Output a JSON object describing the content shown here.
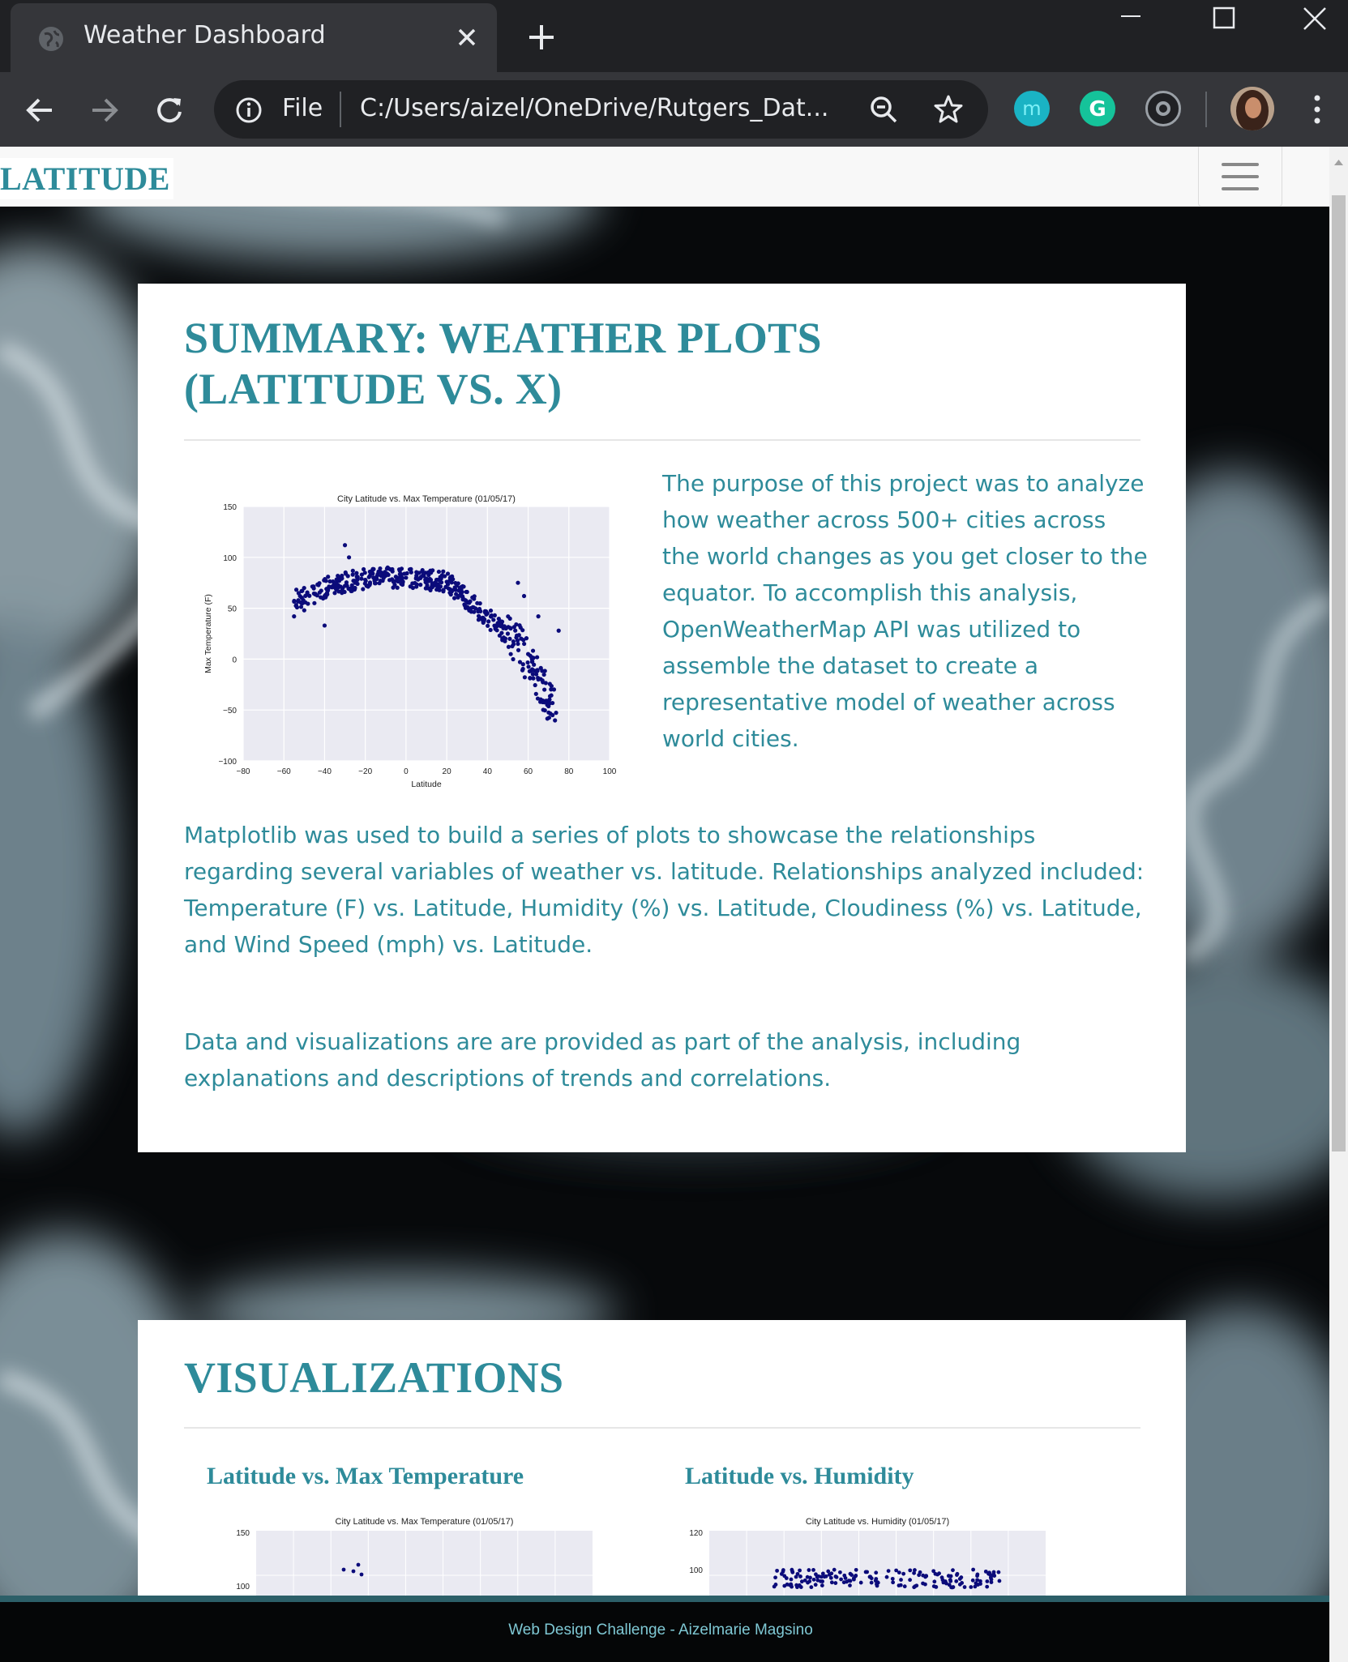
{
  "browser": {
    "tab_title": "Weather Dashboard",
    "omnibox_label": "File",
    "url": "C:/Users/aizel/OneDrive/Rutgers_Dat...",
    "extensions": [
      "m",
      "G",
      ""
    ]
  },
  "navbar": {
    "brand": "LATITUDE"
  },
  "summary": {
    "title_line1": "SUMMARY: WEATHER PLOTS",
    "title_line2": "(LATITUDE VS. X)",
    "paragraphs": [
      "The purpose of this project was to analyze how weather across 500+ cities across the world changes as you get closer to the equator. To accomplish this analysis, OpenWeatherMap API was utilized to assemble the dataset to create a representative model of weather across world cities.",
      "Matplotlib was used to build a series of plots to showcase the relationships regarding several variables of weather vs. latitude. Relationships analyzed included: Temperature (F) vs. Latitude, Humidity (%) vs. Latitude, Cloudiness (%) vs. Latitude, and Wind Speed (mph) vs. Latitude.",
      "Data and visualizations are are provided as part of the analysis, including explanations and descriptions of trends and correlations."
    ]
  },
  "visualizations": {
    "title": "VISUALIZATIONS",
    "items": [
      {
        "label": "Latitude vs. Max Temperature"
      },
      {
        "label": "Latitude vs. Humidity"
      }
    ]
  },
  "footer": {
    "text": "Web Design Challenge - Aizelmarie Magsino"
  },
  "colors": {
    "accent": "#2e8b9a",
    "point": "#0b0b7a",
    "plot_bg": "#eaeaf2",
    "chrome_dark": "#202124",
    "chrome_mid": "#35363a"
  },
  "chart_data": [
    {
      "type": "scatter",
      "title": "City Latitude vs. Max Temperature (01/05/17)",
      "xlabel": "Latitude",
      "ylabel": "Max Temperature (F)",
      "xlim": [
        -80,
        100
      ],
      "ylim": [
        -100,
        150
      ],
      "xticks": [
        "−80",
        "−60",
        "−40",
        "−20",
        "0",
        "20",
        "40",
        "60",
        "80",
        "100"
      ],
      "yticks": [
        "150",
        "100",
        "50",
        "0",
        "−50",
        "−100"
      ],
      "grid": true,
      "point_count_approx": 520,
      "points_sample": [
        [
          -55,
          42
        ],
        [
          -50,
          48
        ],
        [
          -45,
          55
        ],
        [
          -40,
          62
        ],
        [
          -35,
          65
        ],
        [
          -30,
          72
        ],
        [
          -25,
          75
        ],
        [
          -20,
          78
        ],
        [
          -15,
          80
        ],
        [
          -10,
          82
        ],
        [
          -5,
          81
        ],
        [
          0,
          80
        ],
        [
          5,
          80
        ],
        [
          10,
          79
        ],
        [
          15,
          78
        ],
        [
          20,
          76
        ],
        [
          25,
          72
        ],
        [
          30,
          66
        ],
        [
          35,
          55
        ],
        [
          40,
          45
        ],
        [
          45,
          35
        ],
        [
          50,
          25
        ],
        [
          55,
          15
        ],
        [
          60,
          5
        ],
        [
          62,
          -10
        ],
        [
          65,
          -20
        ],
        [
          68,
          -30
        ],
        [
          70,
          -45
        ],
        [
          72,
          -55
        ],
        [
          -30,
          112
        ],
        [
          -28,
          100
        ],
        [
          -40,
          33
        ],
        [
          55,
          75
        ],
        [
          65,
          42
        ],
        [
          75,
          28
        ],
        [
          58,
          62
        ]
      ]
    },
    {
      "type": "scatter",
      "title": "City Latitude vs. Max Temperature (01/05/17)",
      "yticks": [
        "150",
        "100"
      ],
      "partial": true
    },
    {
      "type": "scatter",
      "title": "City Latitude vs. Humidity (01/05/17)",
      "yticks": [
        "120",
        "100"
      ],
      "partial": true
    }
  ]
}
